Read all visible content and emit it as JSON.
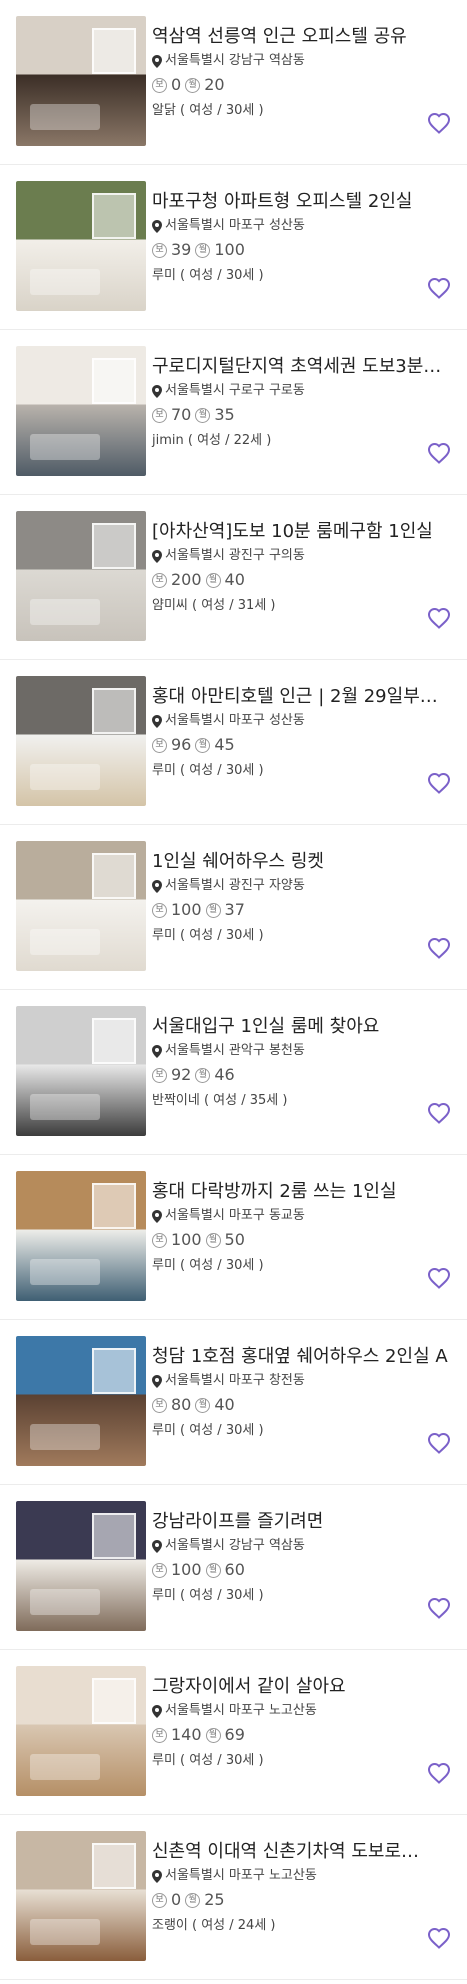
{
  "accent": "#7b61c9",
  "listings": [
    {
      "title": "역삼역 선릉역 인근 오피스텔 공유",
      "address": "서울특별시 강남구 역삼동",
      "deposit": "0",
      "rent": "20",
      "user": "알닭 ( 여성 / 30세 )",
      "photo_colors": [
        "#3b2e26",
        "#8a7767",
        "#d8d0c6"
      ]
    },
    {
      "title": "마포구청 아파트형 오피스텔 2인실",
      "address": "서울특별시 마포구 성산동",
      "deposit": "39",
      "rent": "100",
      "user": "루미 ( 여성 / 30세 )",
      "photo_colors": [
        "#f2efe9",
        "#d9d3c8",
        "#6b7d4f"
      ]
    },
    {
      "title": "구로디지털단지역 초역세권 도보3분…",
      "address": "서울특별시 구로구 구로동",
      "deposit": "70",
      "rent": "35",
      "user": "jimin ( 여성 / 22세 )",
      "photo_colors": [
        "#b9b3ac",
        "#4f5b66",
        "#eeeae4"
      ]
    },
    {
      "title": "[아차산역]도보 10분 룸메구함 1인실",
      "address": "서울특별시 광진구 구의동",
      "deposit": "200",
      "rent": "40",
      "user": "얌미씨 ( 여성 / 31세 )",
      "photo_colors": [
        "#dcd9d3",
        "#c8c3bb",
        "#8d8a86"
      ]
    },
    {
      "title": "홍대 아만티호텔 인근 | 2월 29일부…",
      "address": "서울특별시 마포구 성산동",
      "deposit": "96",
      "rent": "45",
      "user": "루미 ( 여성 / 30세 )",
      "photo_colors": [
        "#f1f1ef",
        "#d4c4a8",
        "#6d6a66"
      ]
    },
    {
      "title": "1인실 쉐어하우스 링켓",
      "address": "서울특별시 광진구 자양동",
      "deposit": "100",
      "rent": "37",
      "user": "루미 ( 여성 / 30세 )",
      "photo_colors": [
        "#f4f2ee",
        "#e0dad0",
        "#b9ad9c"
      ]
    },
    {
      "title": "서울대입구 1인실 룸메 찾아요",
      "address": "서울특별시 관악구 봉천동",
      "deposit": "92",
      "rent": "46",
      "user": "반짝이네 ( 여성 / 35세 )",
      "photo_colors": [
        "#e9e9e9",
        "#3c3c3c",
        "#cfcfcf"
      ]
    },
    {
      "title": "홍대 다락방까지 2룸 쓰는 1인실",
      "address": "서울특별시 마포구 동교동",
      "deposit": "100",
      "rent": "50",
      "user": "루미 ( 여성 / 30세 )",
      "photo_colors": [
        "#eeeeea",
        "#3f5f73",
        "#b68b5b"
      ]
    },
    {
      "title": "청담 1호점 홍대옆 쉐어하우스 2인실 A",
      "address": "서울특별시 마포구 창전동",
      "deposit": "80",
      "rent": "40",
      "user": "루미 ( 여성 / 30세 )",
      "photo_colors": [
        "#5a4132",
        "#a07a5c",
        "#3d78a8"
      ]
    },
    {
      "title": "강남라이프를 즐기려면",
      "address": "서울특별시 강남구 역삼동",
      "deposit": "100",
      "rent": "60",
      "user": "루미 ( 여성 / 30세 )",
      "photo_colors": [
        "#efece6",
        "#7f6b5a",
        "#3b3a52"
      ]
    },
    {
      "title": "그랑자이에서 같이 살아요",
      "address": "서울특별시 마포구 노고산동",
      "deposit": "140",
      "rent": "69",
      "user": "루미 ( 여성 / 30세 )",
      "photo_colors": [
        "#d9c7b2",
        "#b58f66",
        "#e8ddd0"
      ]
    },
    {
      "title": "신촌역 이대역 신촌기차역 도보로…",
      "address": "서울특별시 마포구 노고산동",
      "deposit": "0",
      "rent": "25",
      "user": "조랭이 ( 여성 / 24세 )",
      "photo_colors": [
        "#e8e0d4",
        "#8a5e3c",
        "#c7b7a4"
      ]
    }
  ],
  "labels": {
    "deposit_badge": "보",
    "rent_badge": "월"
  },
  "icons": {
    "pin": "location-pin-icon",
    "heart": "heart-outline-icon"
  }
}
